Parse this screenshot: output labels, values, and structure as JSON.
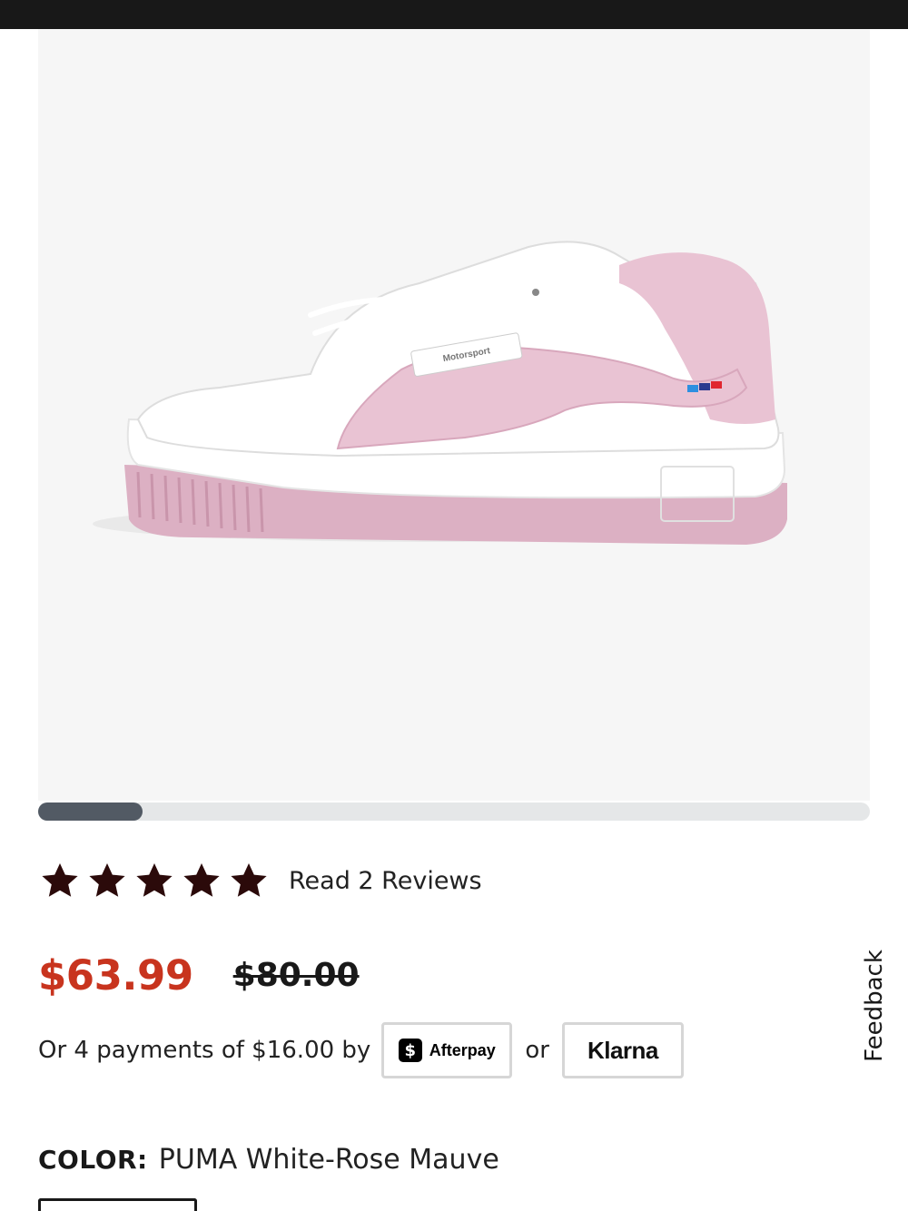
{
  "product": {
    "image": {
      "alt": "PUMA sneaker white and rose mauve",
      "tag_text": "Motorsport",
      "colors": {
        "white": "#ffffff",
        "pink": "#e9c3d3",
        "deep_pink": "#d8a7bc",
        "background": "#f6f6f6"
      }
    },
    "gallery_progress": 0.125,
    "rating": {
      "stars": 5,
      "max": 5,
      "reviews_link": "Read 2 Reviews",
      "star_color": "#2b0a0a"
    },
    "price": {
      "sale": "$63.99",
      "original": "$80.00",
      "sale_color": "#c8341e"
    },
    "payments": {
      "text": "Or 4 payments of $16.00 by",
      "afterpay_icon": "$",
      "afterpay_label": "Afterpay",
      "or_text": "or",
      "klarna_label": "Klarna"
    },
    "color": {
      "label": "COLOR:",
      "value": "PUMA White-Rose Mauve"
    }
  },
  "feedback": {
    "label": "Feedback"
  }
}
